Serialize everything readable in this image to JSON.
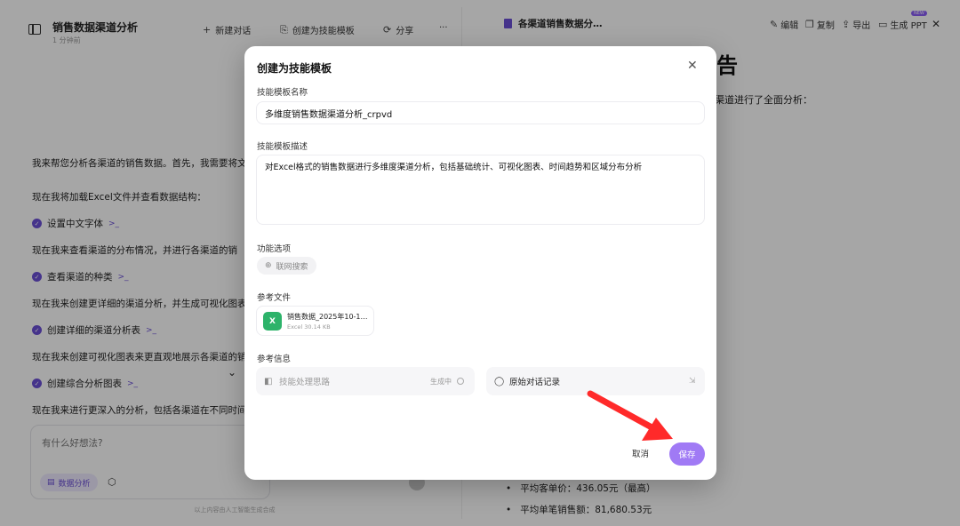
{
  "left_pane": {
    "title": "销售数据渠道分析",
    "subtitle": "1 分钟前",
    "toolbar": {
      "new_chat": "新建对话",
      "create_template": "创建为技能模板",
      "share": "分享",
      "more": "···"
    },
    "messages": [
      "我来帮您分析各渠道的销售数据。首先，我需要将文",
      "现在我将加载Excel文件并查看数据结构：",
      "现在我来查看渠道的分布情况，并进行各渠道的销",
      "现在我来创建更详细的渠道分析，并生成可视化图表",
      "现在我来创建可视化图表来更直观地展示各渠道的销",
      "现在我来进行更深入的分析，包括各渠道在不同时间"
    ],
    "tools": [
      "设置中文字体",
      "查看渠道的种类",
      "创建详细的渠道分析表",
      "创建综合分析图表"
    ],
    "input_placeholder": "有什么好想法?",
    "mode_chip": "数据分析",
    "footnote": "以上内容由人工智能生成合成"
  },
  "right_pane": {
    "tab_title": "各渠道销售数据分…",
    "actions": {
      "edit": "编辑",
      "copy": "复制",
      "export": "导出",
      "ppt": "生成 PPT",
      "new_badge": "NEW"
    },
    "heading_fragment": "告",
    "text_fragment": "渠道进行了全面分析：",
    "bullets": [
      "平均客单价：436.05元（最高）",
      "平均单笔销售额：81,680.53元"
    ]
  },
  "modal": {
    "title": "创建为技能模板",
    "name_label": "技能模板名称",
    "name_value": "多维度销售数据渠道分析_crpvd",
    "desc_label": "技能模板描述",
    "desc_value": "对Excel格式的销售数据进行多维度渠道分析，包括基础统计、可视化图表、时间趋势和区域分布分析",
    "options_label": "功能选项",
    "option_web_search": "联网搜索",
    "ref_files_label": "参考文件",
    "file": {
      "name": "销售数据_2025年10-12…",
      "meta": "Excel 30.14 KB"
    },
    "ref_info_label": "参考信息",
    "ref_approach": "技能处理思路",
    "ref_approach_status": "生成中",
    "ref_original": "原始对话记录",
    "cancel": "取消",
    "save": "保存"
  },
  "colors": {
    "accent": "#a07af5",
    "accent_dark": "#6b4fd6",
    "arrow": "#ff2a2a",
    "excel": "#2db36a"
  }
}
